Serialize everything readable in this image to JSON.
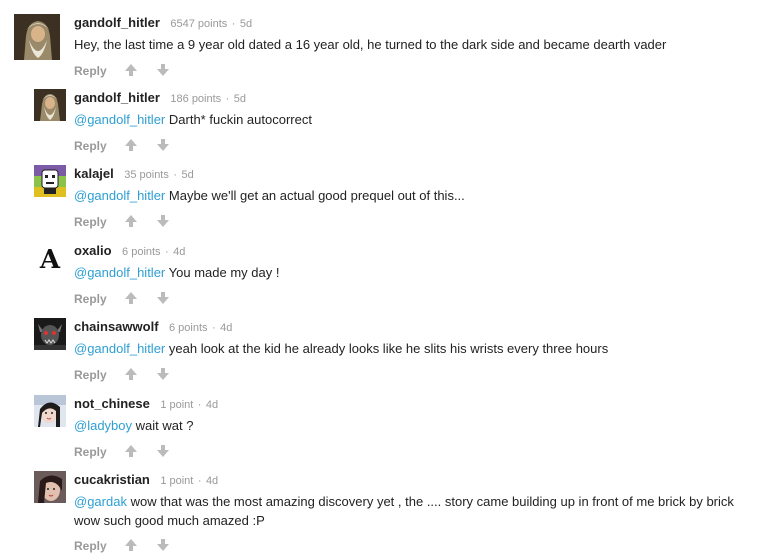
{
  "comments": [
    {
      "username": "gandolf_hitler",
      "points": "6547 points",
      "separator": "·",
      "age": "5d",
      "mention": "",
      "text": "Hey, the last time a 9 year old dated a 16 year old, he turned to the dark side and became dearth vader",
      "reply_label": "Reply"
    },
    {
      "username": "gandolf_hitler",
      "points": "186 points",
      "separator": "·",
      "age": "5d",
      "mention": "@gandolf_hitler",
      "text": "Darth* fuckin autocorrect",
      "reply_label": "Reply"
    },
    {
      "username": "kalajel",
      "points": "35 points",
      "separator": "·",
      "age": "5d",
      "mention": "@gandolf_hitler",
      "text": "Maybe we'll get an actual good prequel out of this...",
      "reply_label": "Reply"
    },
    {
      "username": "oxalio",
      "points": "6 points",
      "separator": "·",
      "age": "4d",
      "mention": "@gandolf_hitler",
      "text": "You made my day !",
      "reply_label": "Reply",
      "avatar_glyph": "A"
    },
    {
      "username": "chainsawwolf",
      "points": "6 points",
      "separator": "·",
      "age": "4d",
      "mention": "@gandolf_hitler",
      "text": "yeah look at the kid he already looks like he slits his wrists every three hours",
      "reply_label": "Reply"
    },
    {
      "username": "not_chinese",
      "points": "1 point",
      "separator": "·",
      "age": "4d",
      "mention": "@ladyboy",
      "text": "wait wat ?",
      "reply_label": "Reply"
    },
    {
      "username": "cucakristian",
      "points": "1 point",
      "separator": "·",
      "age": "4d",
      "mention": "@gardak",
      "text": "wow that was the most amazing discovery yet , the .... story came building up in front of me brick by brick wow such good much amazed :P",
      "reply_label": "Reply"
    }
  ],
  "colors": {
    "mention": "#2e9fd3",
    "meta": "#999999",
    "text": "#222222",
    "vote_icon": "#bbbbbb"
  },
  "icons": {
    "upvote": "upvote-arrow-icon",
    "downvote": "downvote-arrow-icon"
  }
}
